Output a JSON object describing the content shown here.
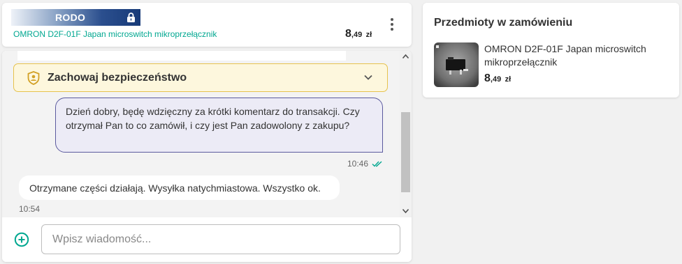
{
  "header": {
    "badge_label": "RODO",
    "product_title": "OMRON D2F-01F Japan microswitch mikroprzełącznik",
    "price": {
      "int": "8",
      "frac": ",49",
      "currency": "zł"
    }
  },
  "chat": {
    "safety_title": "Zachowaj bezpieczeństwo",
    "messages": [
      {
        "direction": "outgoing",
        "text": "Dzień dobry, będę wdzięczny za krótki komentarz do transakcji. Czy otrzymał Pan to co zamówił, i czy jest Pan zadowolony z zakupu?",
        "time": "10:46",
        "read": true
      },
      {
        "direction": "incoming",
        "text": "Otrzymane części działają. Wysyłka natychmiastowa. Wszystko ok.",
        "time": "10:54"
      }
    ],
    "input_placeholder": "Wpisz wiadomość...",
    "input_value": ""
  },
  "order_panel": {
    "title": "Przedmioty w zamówieniu",
    "items": [
      {
        "name": "OMRON D2F-01F Japan microswitch mikroprzełącznik",
        "price": {
          "int": "8",
          "frac": ",49",
          "currency": "zł"
        }
      }
    ]
  },
  "colors": {
    "accent_green": "#00a790",
    "outgoing_bubble": "#ecebf6",
    "outgoing_border": "#5b5a9e",
    "warning_bg": "#fdf7dd",
    "warning_border": "#e6c24d",
    "badge_blue": "#173a78"
  },
  "icons": [
    "lock-icon",
    "kebab-menu-icon",
    "shield-user-icon",
    "chevron-down-icon",
    "double-check-icon",
    "add-circle-icon",
    "scroll-up-icon",
    "scroll-down-icon"
  ]
}
